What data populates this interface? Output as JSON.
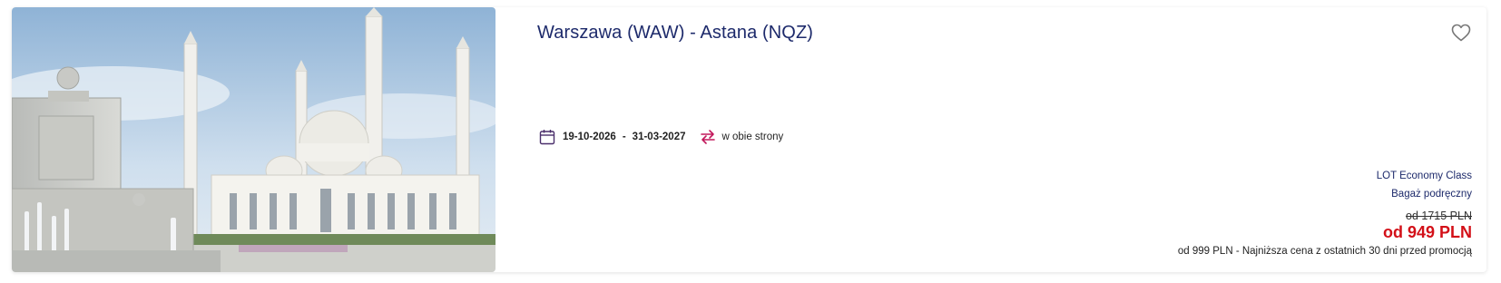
{
  "offer": {
    "title": "Warszawa (WAW) - Astana (NQZ)",
    "date_from": "19-10-2026",
    "date_separator": "-",
    "date_to": "31-03-2027",
    "trip_type": "w obie strony",
    "cabin_class": "LOT Economy Class",
    "baggage": "Bagaż podręczny",
    "old_price": "od 1715 PLN",
    "new_price": "od 949 PLN",
    "lowest_price_note": "od 999 PLN - Najniższa cena z ostatnich 30 dni przed promocją"
  },
  "icons": {
    "favorite": "heart-outline-icon",
    "calendar": "calendar-icon",
    "trip": "round-trip-arrows-icon"
  },
  "colors": {
    "title": "#1d2a6b",
    "price_red": "#d31018",
    "calendar_icon": "#4a2f6b",
    "trip_icon": "#c2185b"
  }
}
